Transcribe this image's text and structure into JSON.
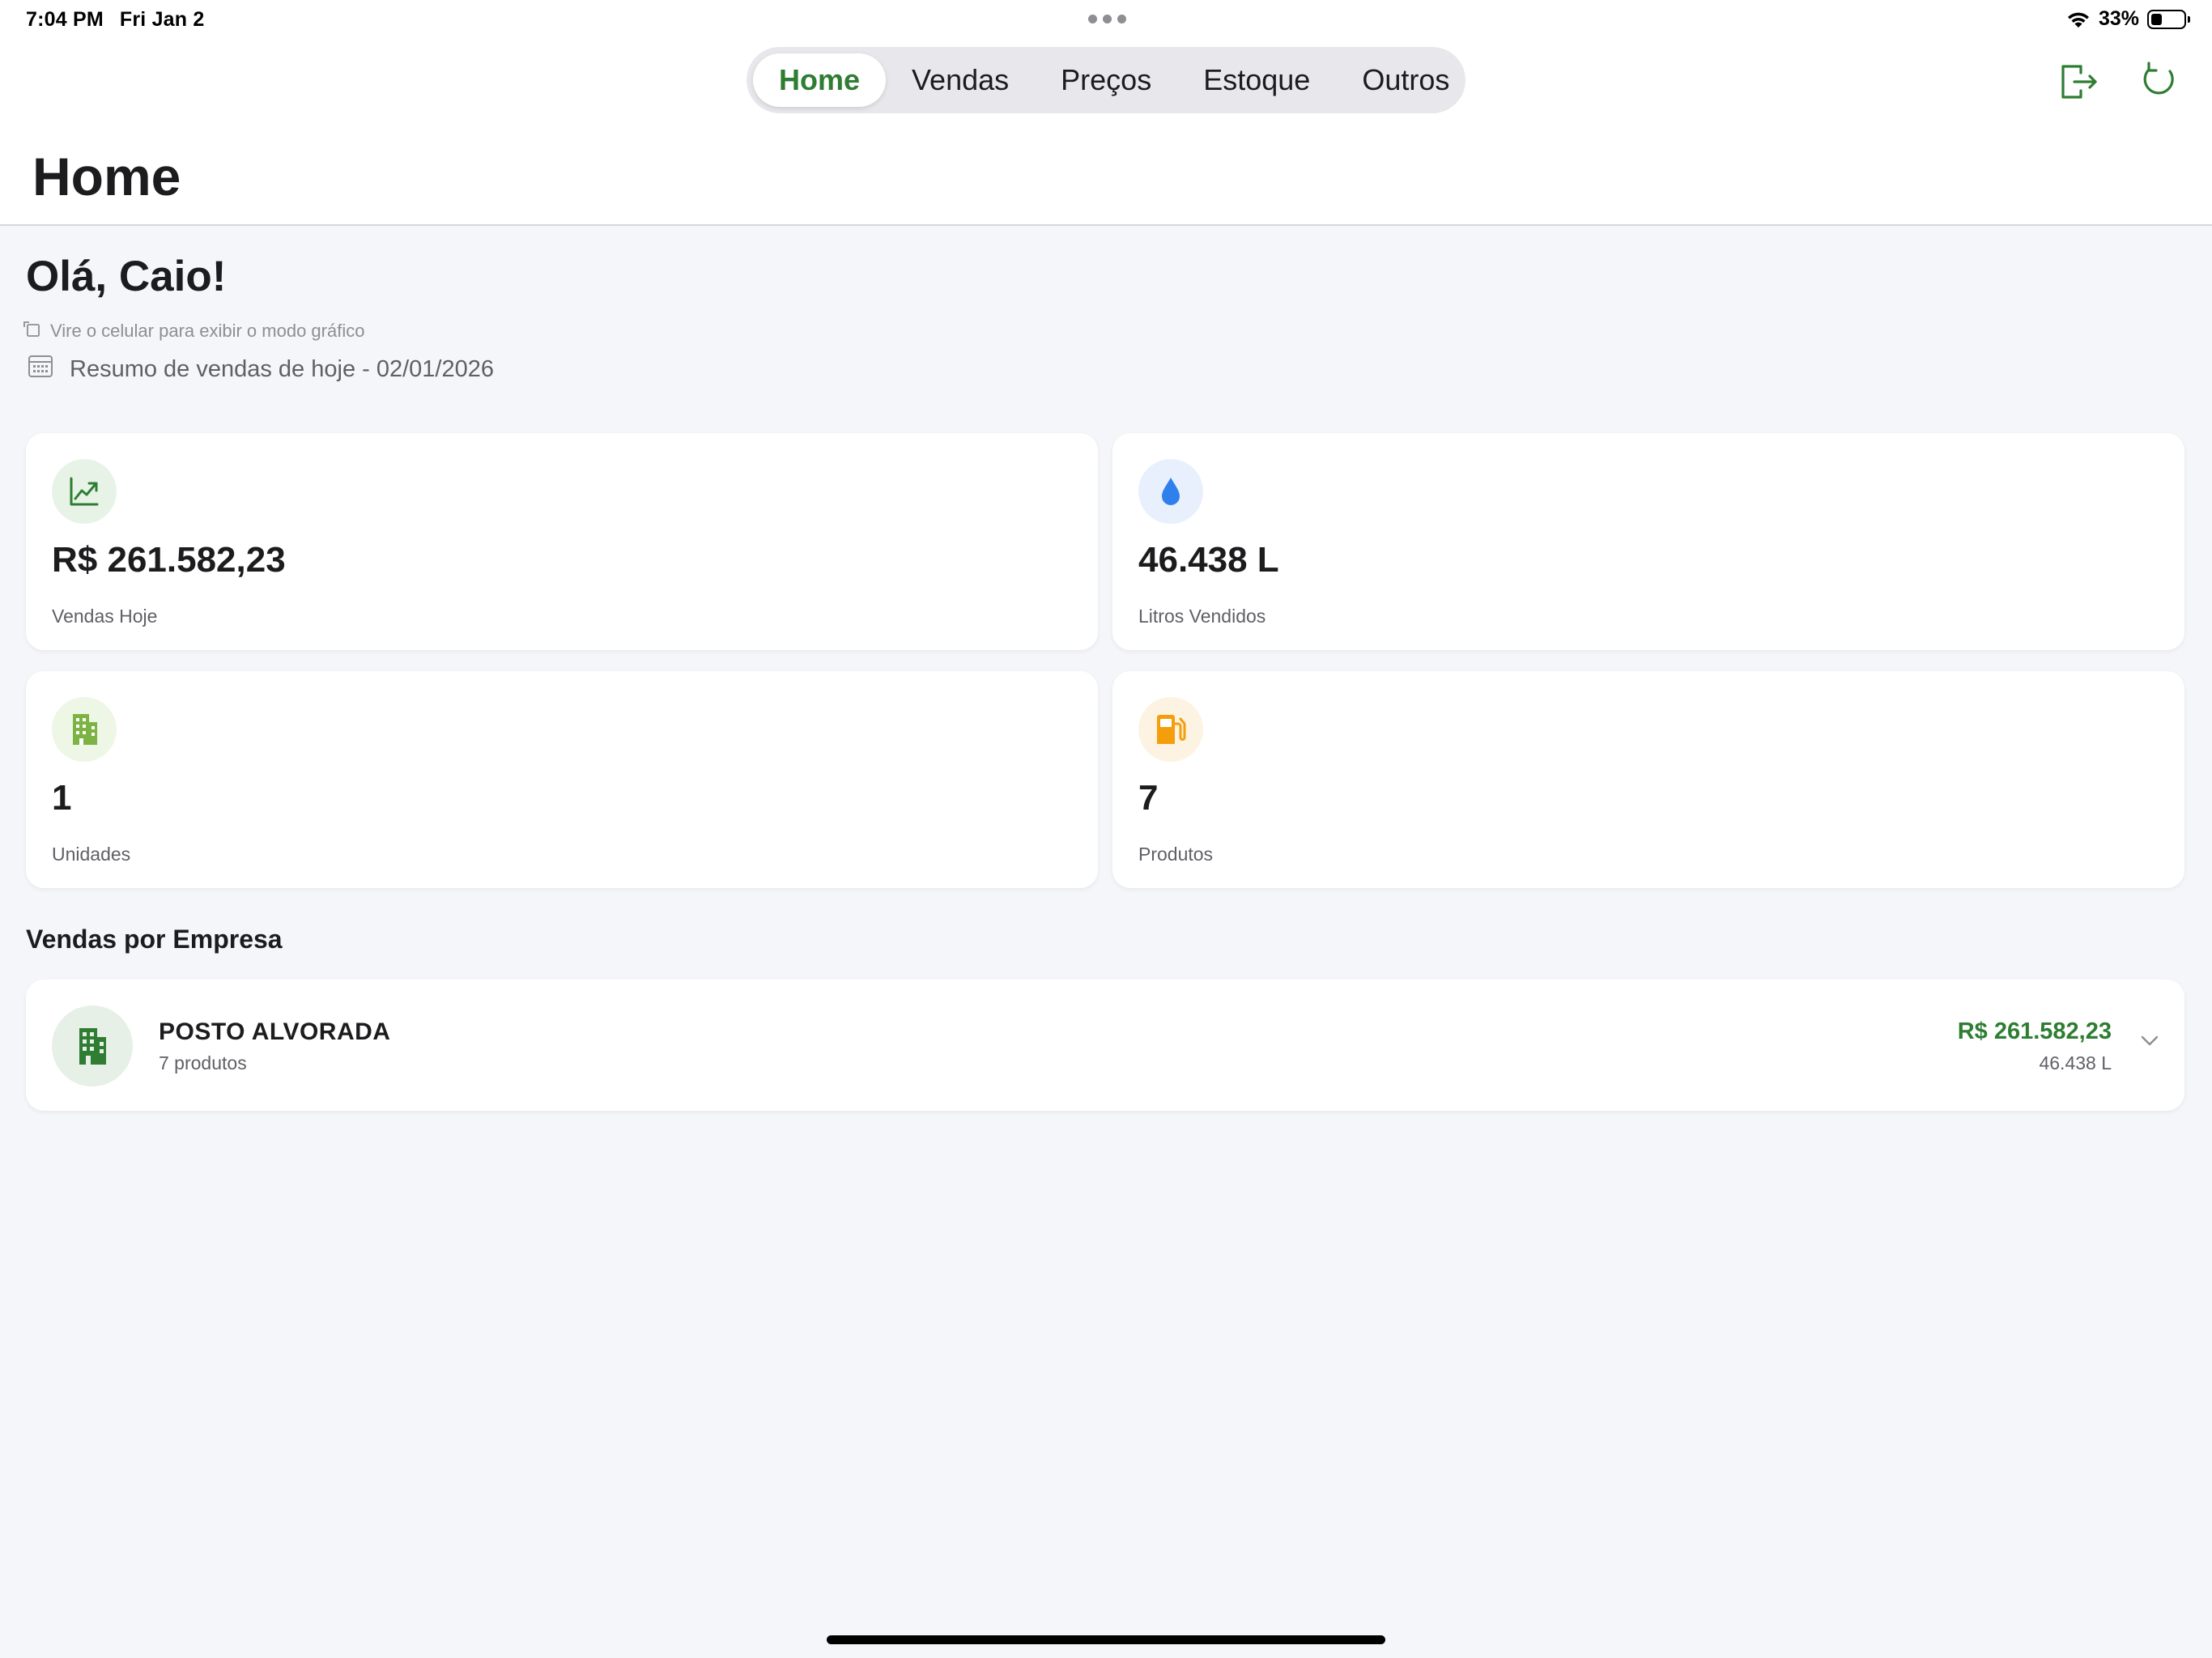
{
  "status_bar": {
    "time": "7:04 PM",
    "date": "Fri Jan 2",
    "battery": "33%",
    "battery_level": 0.33
  },
  "nav": {
    "tabs": [
      {
        "label": "Home",
        "active": true
      },
      {
        "label": "Vendas",
        "active": false
      },
      {
        "label": "Preços",
        "active": false
      },
      {
        "label": "Estoque",
        "active": false
      },
      {
        "label": "Outros",
        "active": false
      }
    ]
  },
  "toolbar": {
    "logout_icon": "logout-icon",
    "refresh_icon": "refresh-icon"
  },
  "page": {
    "title": "Home",
    "greeting": "Olá, Caio!",
    "rotate_hint": "Vire o celular para exibir o modo gráfico",
    "summary": "Resumo de vendas de hoje - 02/01/2026"
  },
  "stats": [
    {
      "value": "R$ 261.582,23",
      "label": "Vendas Hoje",
      "icon": "trending-up-icon",
      "color": "#2e7d32",
      "bg": "#e8f3e8"
    },
    {
      "value": "46.438 L",
      "label": "Litros Vendidos",
      "icon": "water-drop-icon",
      "color": "#2f80ed",
      "bg": "#e8f0fd"
    },
    {
      "value": "1",
      "label": "Unidades",
      "icon": "building-icon",
      "color": "#7cb342",
      "bg": "#eef6e6"
    },
    {
      "value": "7",
      "label": "Produtos",
      "icon": "fuel-pump-icon",
      "color": "#f59e0b",
      "bg": "#fdf3e3"
    }
  ],
  "section": {
    "title": "Vendas por Empresa"
  },
  "companies": [
    {
      "name": "POSTO ALVORADA",
      "products": "7 produtos",
      "amount": "R$ 261.582,23",
      "liters": "46.438 L"
    }
  ],
  "colors": {
    "accent": "#2e7d32",
    "background": "#f5f6f9"
  }
}
